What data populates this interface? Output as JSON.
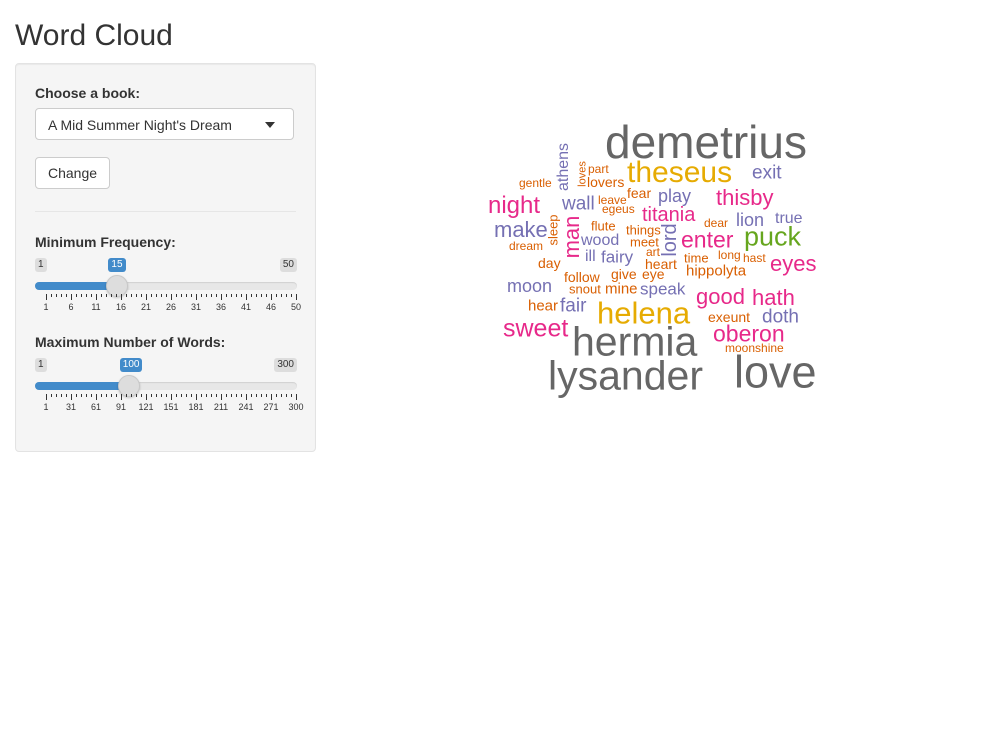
{
  "app": {
    "title": "Word Cloud"
  },
  "sidebar": {
    "book_label": "Choose a book:",
    "book_selected": "A Mid Summer Night's Dream",
    "change_button": "Change",
    "min_freq": {
      "label": "Minimum Frequency:",
      "min": "1",
      "max": "50",
      "value": "15",
      "ticks": [
        "1",
        "6",
        "11",
        "16",
        "21",
        "26",
        "31",
        "36",
        "41",
        "46",
        "50"
      ]
    },
    "max_words": {
      "label": "Maximum Number of Words:",
      "min": "1",
      "max": "300",
      "value": "100",
      "ticks": [
        "1",
        "31",
        "61",
        "91",
        "121",
        "151",
        "181",
        "211",
        "241",
        "271",
        "300"
      ]
    }
  },
  "colors": {
    "gray": "#666666",
    "gold": "#e6ab02",
    "pink": "#e7298a",
    "purple": "#7570b3",
    "orange": "#d95f02",
    "green": "#66a61e",
    "slider_blue": "#428bca"
  },
  "cloud": {
    "words": [
      {
        "text": "demetrius",
        "color": "gray"
      },
      {
        "text": "theseus",
        "color": "gold"
      },
      {
        "text": "exit",
        "color": "purple"
      },
      {
        "text": "play",
        "color": "purple"
      },
      {
        "text": "thisby",
        "color": "pink"
      },
      {
        "text": "athens",
        "color": "purple"
      },
      {
        "text": "part",
        "color": "orange"
      },
      {
        "text": "loves",
        "color": "orange"
      },
      {
        "text": "gentle",
        "color": "orange"
      },
      {
        "text": "lovers",
        "color": "orange"
      },
      {
        "text": "fear",
        "color": "orange"
      },
      {
        "text": "leave",
        "color": "orange"
      },
      {
        "text": "egeus",
        "color": "orange"
      },
      {
        "text": "night",
        "color": "pink"
      },
      {
        "text": "wall",
        "color": "purple"
      },
      {
        "text": "titania",
        "color": "pink"
      },
      {
        "text": "dear",
        "color": "orange"
      },
      {
        "text": "lion",
        "color": "purple"
      },
      {
        "text": "true",
        "color": "purple"
      },
      {
        "text": "make",
        "color": "purple"
      },
      {
        "text": "sleep",
        "color": "orange"
      },
      {
        "text": "man",
        "color": "pink"
      },
      {
        "text": "flute",
        "color": "orange"
      },
      {
        "text": "things",
        "color": "orange"
      },
      {
        "text": "lord",
        "color": "purple"
      },
      {
        "text": "enter",
        "color": "pink"
      },
      {
        "text": "puck",
        "color": "green"
      },
      {
        "text": "dream",
        "color": "orange"
      },
      {
        "text": "wood",
        "color": "purple"
      },
      {
        "text": "meet",
        "color": "orange"
      },
      {
        "text": "art",
        "color": "orange"
      },
      {
        "text": "ill",
        "color": "purple"
      },
      {
        "text": "fairy",
        "color": "purple"
      },
      {
        "text": "time",
        "color": "orange"
      },
      {
        "text": "long",
        "color": "orange"
      },
      {
        "text": "hast",
        "color": "orange"
      },
      {
        "text": "eyes",
        "color": "pink"
      },
      {
        "text": "day",
        "color": "orange"
      },
      {
        "text": "heart",
        "color": "orange"
      },
      {
        "text": "hippolyta",
        "color": "orange"
      },
      {
        "text": "follow",
        "color": "orange"
      },
      {
        "text": "give",
        "color": "orange"
      },
      {
        "text": "eye",
        "color": "orange"
      },
      {
        "text": "moon",
        "color": "purple"
      },
      {
        "text": "snout",
        "color": "orange"
      },
      {
        "text": "mine",
        "color": "orange"
      },
      {
        "text": "speak",
        "color": "purple"
      },
      {
        "text": "good",
        "color": "pink"
      },
      {
        "text": "hath",
        "color": "pink"
      },
      {
        "text": "hear",
        "color": "orange"
      },
      {
        "text": "fair",
        "color": "purple"
      },
      {
        "text": "helena",
        "color": "gold"
      },
      {
        "text": "exeunt",
        "color": "orange"
      },
      {
        "text": "doth",
        "color": "purple"
      },
      {
        "text": "sweet",
        "color": "pink"
      },
      {
        "text": "oberon",
        "color": "pink"
      },
      {
        "text": "moonshine",
        "color": "orange"
      },
      {
        "text": "hermia",
        "color": "gray"
      },
      {
        "text": "lysander",
        "color": "gray"
      },
      {
        "text": "love",
        "color": "gray"
      }
    ]
  }
}
